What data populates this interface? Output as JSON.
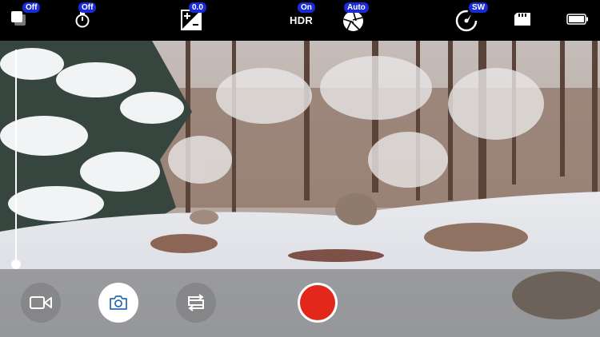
{
  "topbar": {
    "layers": {
      "icon": "layers-icon",
      "badge": "Off"
    },
    "timer": {
      "icon": "stopwatch-icon",
      "badge": "Off"
    },
    "exposure": {
      "icon": "exposure-plus-minus-icon",
      "badge": "0.0"
    },
    "hdr": {
      "label": "HDR",
      "badge": "On"
    },
    "aperture": {
      "icon": "aperture-icon",
      "badge": "Auto"
    },
    "shutter_speed": {
      "icon": "shutter-speed-icon",
      "badge": "SW"
    },
    "storage": {
      "icon": "sd-card-icon"
    },
    "battery": {
      "icon": "battery-icon"
    }
  },
  "colors": {
    "badge": "#1a2bd6",
    "record": "#e3271b",
    "bar": "#000000"
  },
  "zoom": {
    "level": 0
  },
  "bottombar": {
    "video_mode": {
      "icon": "video-camera-icon"
    },
    "photo_mode": {
      "icon": "camera-icon",
      "selected": true
    },
    "switch_camera": {
      "icon": "flip-camera-icon"
    },
    "record": {
      "icon": "record-icon"
    }
  }
}
